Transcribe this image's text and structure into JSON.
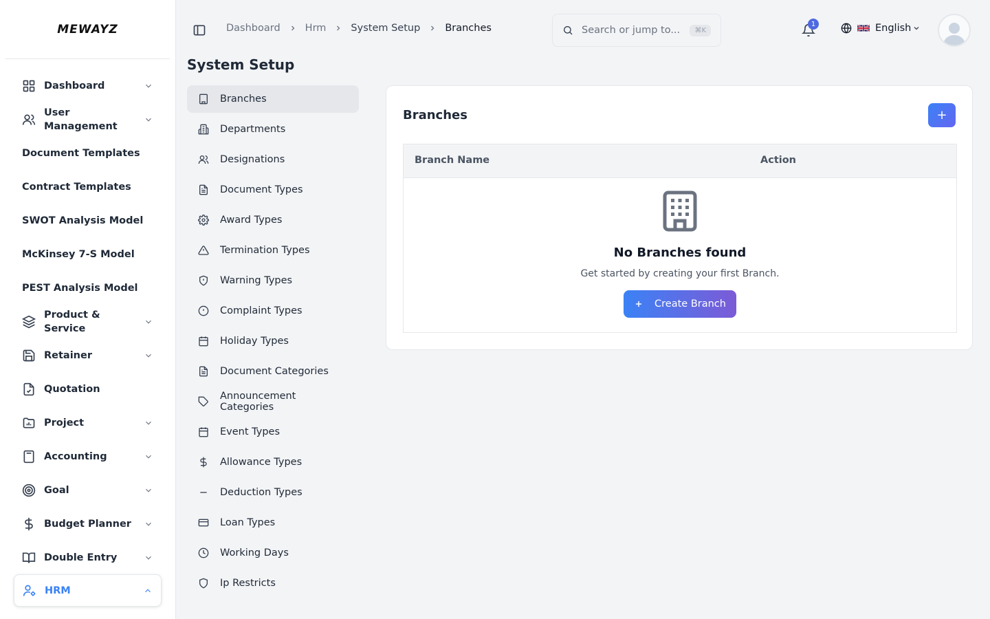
{
  "brand": {
    "logo": "MEWAYZ"
  },
  "sidebar": {
    "items": [
      {
        "label": "Dashboard",
        "icon": "grid-icon",
        "chevron": true
      },
      {
        "label": "User Management",
        "icon": "users-icon",
        "chevron": true
      },
      {
        "label": "Document Templates",
        "icon": "",
        "chevron": false
      },
      {
        "label": "Contract Templates",
        "icon": "",
        "chevron": false
      },
      {
        "label": "SWOT Analysis Model",
        "icon": "",
        "chevron": false
      },
      {
        "label": "McKinsey 7-S Model",
        "icon": "",
        "chevron": false
      },
      {
        "label": "PEST Analysis Model",
        "icon": "",
        "chevron": false
      },
      {
        "label": "Product & Service",
        "icon": "layers-icon",
        "chevron": true
      },
      {
        "label": "Retainer",
        "icon": "save-icon",
        "chevron": true
      },
      {
        "label": "Quotation",
        "icon": "file-check-icon",
        "chevron": false
      },
      {
        "label": "Project",
        "icon": "folder-chart-icon",
        "chevron": true
      },
      {
        "label": "Accounting",
        "icon": "calculator-icon",
        "chevron": true
      },
      {
        "label": "Goal",
        "icon": "target-icon",
        "chevron": true
      },
      {
        "label": "Budget Planner",
        "icon": "dollar-icon",
        "chevron": true
      },
      {
        "label": "Double Entry",
        "icon": "book-icon",
        "chevron": true
      },
      {
        "label": "HRM",
        "icon": "user-cog-icon",
        "chevron": true,
        "active": true
      }
    ]
  },
  "header": {
    "breadcrumb": [
      "Dashboard",
      "Hrm",
      "System Setup",
      "Branches"
    ],
    "search_placeholder": "Search or jump to...",
    "search_shortcut": "⌘K",
    "notification_count": "1",
    "language": "English",
    "accent_color": "#4f6ae0"
  },
  "page": {
    "title": "System Setup",
    "submenu": [
      {
        "label": "Branches",
        "icon": "building-icon",
        "active": true
      },
      {
        "label": "Departments",
        "icon": "building-2-icon"
      },
      {
        "label": "Designations",
        "icon": "users-icon"
      },
      {
        "label": "Document Types",
        "icon": "file-text-icon"
      },
      {
        "label": "Award Types",
        "icon": "gear-icon"
      },
      {
        "label": "Termination Types",
        "icon": "warning-triangle-icon"
      },
      {
        "label": "Warning Types",
        "icon": "shield-alert-icon"
      },
      {
        "label": "Complaint Types",
        "icon": "alert-circle-icon"
      },
      {
        "label": "Holiday Types",
        "icon": "calendar-icon"
      },
      {
        "label": "Document Categories",
        "icon": "file-text-icon"
      },
      {
        "label": "Announcement Categories",
        "icon": "tag-icon"
      },
      {
        "label": "Event Types",
        "icon": "calendar-icon"
      },
      {
        "label": "Allowance Types",
        "icon": "dollar-icon"
      },
      {
        "label": "Deduction Types",
        "icon": "minus-icon"
      },
      {
        "label": "Loan Types",
        "icon": "credit-card-icon"
      },
      {
        "label": "Working Days",
        "icon": "clock-icon"
      },
      {
        "label": "Ip Restricts",
        "icon": "shield-icon"
      }
    ]
  },
  "card": {
    "title": "Branches",
    "add_label": "+",
    "columns": [
      "Branch Name",
      "Action"
    ],
    "empty": {
      "title": "No Branches found",
      "subtitle": "Get started by creating your first Branch.",
      "button_label": "Create Branch"
    }
  }
}
